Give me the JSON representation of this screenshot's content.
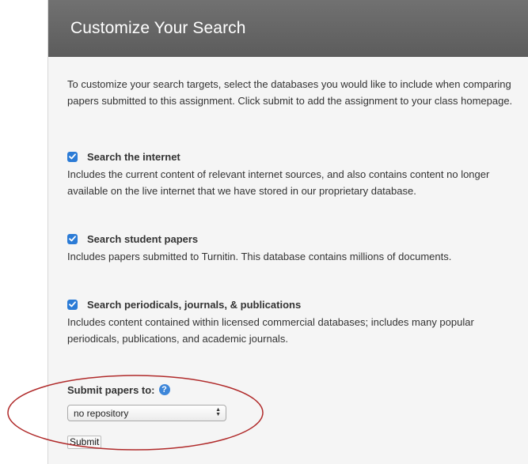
{
  "header": {
    "title": "Customize Your Search"
  },
  "intro": {
    "text": "To customize your search targets, select the databases you would like to include when comparing papers submitted to this assignment. Click submit to add the assignment to your class homepage."
  },
  "options": [
    {
      "checked": true,
      "title": "Search the internet",
      "description": "Includes the current content of relevant internet sources, and also contains content no longer available on the live internet that we have stored in our proprietary database."
    },
    {
      "checked": true,
      "title": "Search student papers",
      "description": "Includes papers submitted to Turnitin. This database contains millions of documents."
    },
    {
      "checked": true,
      "title": "Search periodicals, journals, & publications",
      "description": "Includes content contained within licensed commercial databases; includes many popular periodicals, publications, and academic journals."
    }
  ],
  "repository": {
    "label": "Submit papers to:",
    "help_icon": "?",
    "selected": "no repository"
  },
  "submit": {
    "label": "Submit"
  },
  "colors": {
    "header_bg": "#676767",
    "checkbox": "#2b7bd6",
    "help_icon": "#3d86d9",
    "annotation_ellipse": "#b02a2a"
  }
}
